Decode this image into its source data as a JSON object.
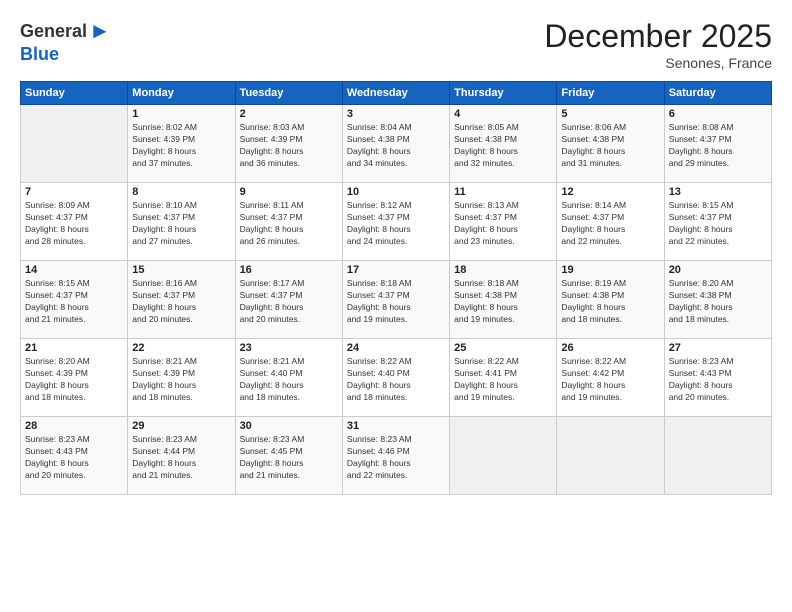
{
  "logo": {
    "general": "General",
    "blue": "Blue",
    "arrow": "▶"
  },
  "header": {
    "month": "December 2025",
    "location": "Senones, France"
  },
  "days_header": [
    "Sunday",
    "Monday",
    "Tuesday",
    "Wednesday",
    "Thursday",
    "Friday",
    "Saturday"
  ],
  "weeks": [
    [
      {
        "day": "",
        "info": ""
      },
      {
        "day": "1",
        "info": "Sunrise: 8:02 AM\nSunset: 4:39 PM\nDaylight: 8 hours\nand 37 minutes."
      },
      {
        "day": "2",
        "info": "Sunrise: 8:03 AM\nSunset: 4:39 PM\nDaylight: 8 hours\nand 36 minutes."
      },
      {
        "day": "3",
        "info": "Sunrise: 8:04 AM\nSunset: 4:38 PM\nDaylight: 8 hours\nand 34 minutes."
      },
      {
        "day": "4",
        "info": "Sunrise: 8:05 AM\nSunset: 4:38 PM\nDaylight: 8 hours\nand 32 minutes."
      },
      {
        "day": "5",
        "info": "Sunrise: 8:06 AM\nSunset: 4:38 PM\nDaylight: 8 hours\nand 31 minutes."
      },
      {
        "day": "6",
        "info": "Sunrise: 8:08 AM\nSunset: 4:37 PM\nDaylight: 8 hours\nand 29 minutes."
      }
    ],
    [
      {
        "day": "7",
        "info": "Sunrise: 8:09 AM\nSunset: 4:37 PM\nDaylight: 8 hours\nand 28 minutes."
      },
      {
        "day": "8",
        "info": "Sunrise: 8:10 AM\nSunset: 4:37 PM\nDaylight: 8 hours\nand 27 minutes."
      },
      {
        "day": "9",
        "info": "Sunrise: 8:11 AM\nSunset: 4:37 PM\nDaylight: 8 hours\nand 26 minutes."
      },
      {
        "day": "10",
        "info": "Sunrise: 8:12 AM\nSunset: 4:37 PM\nDaylight: 8 hours\nand 24 minutes."
      },
      {
        "day": "11",
        "info": "Sunrise: 8:13 AM\nSunset: 4:37 PM\nDaylight: 8 hours\nand 23 minutes."
      },
      {
        "day": "12",
        "info": "Sunrise: 8:14 AM\nSunset: 4:37 PM\nDaylight: 8 hours\nand 22 minutes."
      },
      {
        "day": "13",
        "info": "Sunrise: 8:15 AM\nSunset: 4:37 PM\nDaylight: 8 hours\nand 22 minutes."
      }
    ],
    [
      {
        "day": "14",
        "info": "Sunrise: 8:15 AM\nSunset: 4:37 PM\nDaylight: 8 hours\nand 21 minutes."
      },
      {
        "day": "15",
        "info": "Sunrise: 8:16 AM\nSunset: 4:37 PM\nDaylight: 8 hours\nand 20 minutes."
      },
      {
        "day": "16",
        "info": "Sunrise: 8:17 AM\nSunset: 4:37 PM\nDaylight: 8 hours\nand 20 minutes."
      },
      {
        "day": "17",
        "info": "Sunrise: 8:18 AM\nSunset: 4:37 PM\nDaylight: 8 hours\nand 19 minutes."
      },
      {
        "day": "18",
        "info": "Sunrise: 8:18 AM\nSunset: 4:38 PM\nDaylight: 8 hours\nand 19 minutes."
      },
      {
        "day": "19",
        "info": "Sunrise: 8:19 AM\nSunset: 4:38 PM\nDaylight: 8 hours\nand 18 minutes."
      },
      {
        "day": "20",
        "info": "Sunrise: 8:20 AM\nSunset: 4:38 PM\nDaylight: 8 hours\nand 18 minutes."
      }
    ],
    [
      {
        "day": "21",
        "info": "Sunrise: 8:20 AM\nSunset: 4:39 PM\nDaylight: 8 hours\nand 18 minutes."
      },
      {
        "day": "22",
        "info": "Sunrise: 8:21 AM\nSunset: 4:39 PM\nDaylight: 8 hours\nand 18 minutes."
      },
      {
        "day": "23",
        "info": "Sunrise: 8:21 AM\nSunset: 4:40 PM\nDaylight: 8 hours\nand 18 minutes."
      },
      {
        "day": "24",
        "info": "Sunrise: 8:22 AM\nSunset: 4:40 PM\nDaylight: 8 hours\nand 18 minutes."
      },
      {
        "day": "25",
        "info": "Sunrise: 8:22 AM\nSunset: 4:41 PM\nDaylight: 8 hours\nand 19 minutes."
      },
      {
        "day": "26",
        "info": "Sunrise: 8:22 AM\nSunset: 4:42 PM\nDaylight: 8 hours\nand 19 minutes."
      },
      {
        "day": "27",
        "info": "Sunrise: 8:23 AM\nSunset: 4:43 PM\nDaylight: 8 hours\nand 20 minutes."
      }
    ],
    [
      {
        "day": "28",
        "info": "Sunrise: 8:23 AM\nSunset: 4:43 PM\nDaylight: 8 hours\nand 20 minutes."
      },
      {
        "day": "29",
        "info": "Sunrise: 8:23 AM\nSunset: 4:44 PM\nDaylight: 8 hours\nand 21 minutes."
      },
      {
        "day": "30",
        "info": "Sunrise: 8:23 AM\nSunset: 4:45 PM\nDaylight: 8 hours\nand 21 minutes."
      },
      {
        "day": "31",
        "info": "Sunrise: 8:23 AM\nSunset: 4:46 PM\nDaylight: 8 hours\nand 22 minutes."
      },
      {
        "day": "",
        "info": ""
      },
      {
        "day": "",
        "info": ""
      },
      {
        "day": "",
        "info": ""
      }
    ]
  ]
}
